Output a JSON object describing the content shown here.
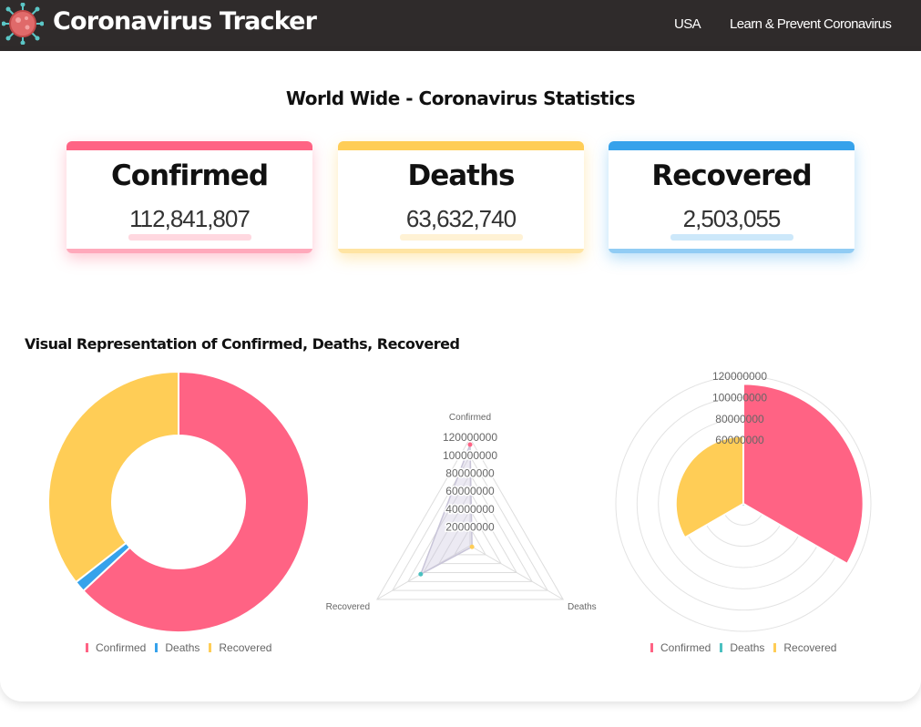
{
  "nav": {
    "brand": "Coronavirus Tracker",
    "links": [
      "USA",
      "Learn & Prevent Coronavirus"
    ]
  },
  "page": {
    "heading": "World Wide - Coronavirus Statistics",
    "section_title": "Visual Representation of Confirmed, Deaths, Recovered"
  },
  "stats": [
    {
      "title": "Confirmed",
      "value": "112,841,807",
      "color": "#ff6384"
    },
    {
      "title": "Deaths",
      "value": "63,632,740",
      "color": "#ffcd56"
    },
    {
      "title": "Recovered",
      "value": "2,503,055",
      "color": "#36a2eb"
    }
  ],
  "chart_data": [
    {
      "type": "doughnut",
      "categories": [
        "Confirmed",
        "Deaths",
        "Recovered"
      ],
      "values": [
        112841807,
        2503055,
        63632740
      ],
      "colors": [
        "#ff6384",
        "#36a2eb",
        "#ffcd56"
      ],
      "legend": [
        "Confirmed",
        "Deaths",
        "Recovered"
      ],
      "legend_colors": [
        "#ff6384",
        "#36a2eb",
        "#ffcd56"
      ],
      "legend_position": "bottom"
    },
    {
      "type": "radar",
      "categories": [
        "Confirmed",
        "Deaths",
        "Recovered"
      ],
      "values": [
        112841807,
        2503055,
        63632740
      ],
      "point_colors": [
        "#ff6384",
        "#ffcd56",
        "#4bc0c0"
      ],
      "ticks": [
        "20000000",
        "40000000",
        "60000000",
        "80000000",
        "100000000",
        "120000000"
      ],
      "rmax": 120000000
    },
    {
      "type": "polarArea",
      "categories": [
        "Confirmed",
        "Deaths",
        "Recovered"
      ],
      "values": [
        112841807,
        2503055,
        63632740
      ],
      "colors": [
        "#ff6384",
        "#4bc0c0",
        "#ffcd56"
      ],
      "ticks": [
        "120000000",
        "100000000",
        "80000000",
        "60000000"
      ],
      "rmax": 120000000,
      "legend": [
        "Confirmed",
        "Deaths",
        "Recovered"
      ],
      "legend_colors": [
        "#ff6384",
        "#4bc0c0",
        "#ffcd56"
      ],
      "legend_position": "bottom"
    }
  ]
}
